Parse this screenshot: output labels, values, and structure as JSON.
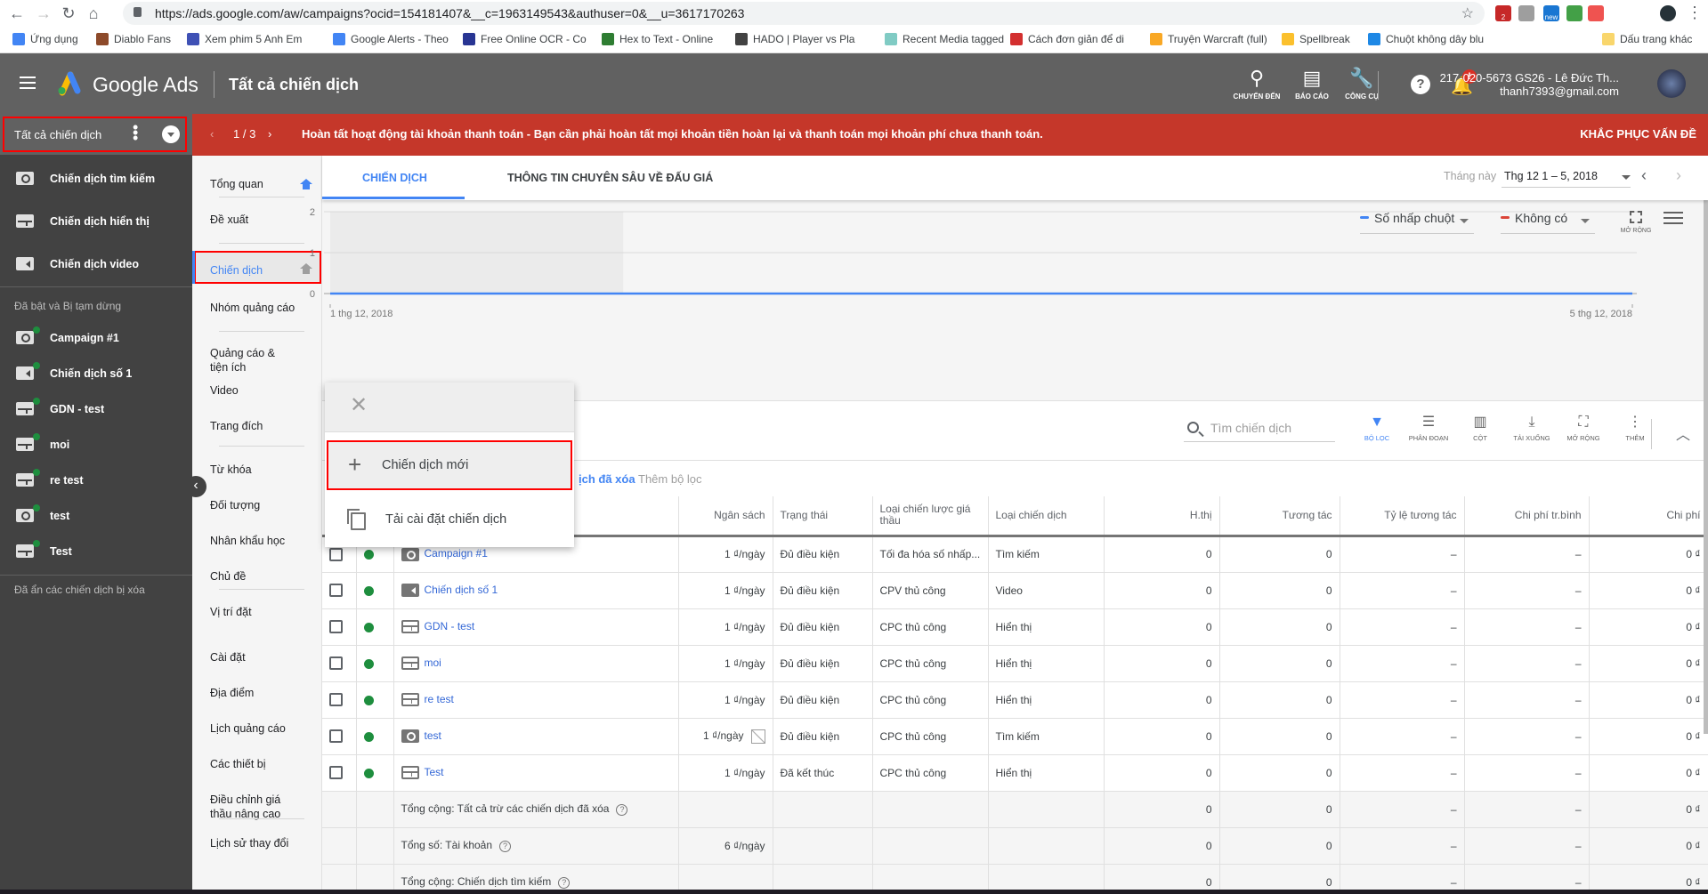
{
  "browser": {
    "url": "https://ads.google.com/aw/campaigns?ocid=154181407&__c=1963149543&authuser=0&__u=3617170263",
    "extensions": [
      {
        "name": "gmail-extension",
        "badge": "2",
        "color": "#c62828"
      },
      {
        "name": "shield-extension",
        "color": "#9e9e9e"
      },
      {
        "name": "new-extension",
        "badge": "new",
        "color": "#1976d2"
      },
      {
        "name": "globe-extension",
        "color": "#43a047"
      },
      {
        "name": "arrow-extension",
        "color": "#ef5350"
      }
    ],
    "bookmarks": [
      {
        "label": "Ứng dụng",
        "color": "#4285f4"
      },
      {
        "label": "Diablo Fans",
        "color": "#8d4a2a"
      },
      {
        "label": "Xem phim 5 Anh Em",
        "color": "#3f51b5"
      },
      {
        "label": "Google Alerts - Theo",
        "color": "#4285f4"
      },
      {
        "label": "Free Online OCR - Co",
        "color": "#283593"
      },
      {
        "label": "Hex to Text - Online",
        "color": "#2e7d32"
      },
      {
        "label": "HADO | Player vs Pla",
        "color": "#424242"
      },
      {
        "label": "Recent Media tagged",
        "color": "#80cbc4"
      },
      {
        "label": "Cách đơn giản để di",
        "color": "#d32f2f"
      },
      {
        "label": "Truyện Warcraft (full)",
        "color": "#f9a825"
      },
      {
        "label": "Spellbreak",
        "color": "#fbc02d"
      },
      {
        "label": "Chuột không dây blu",
        "color": "#1e88e5"
      }
    ],
    "other_bookmarks": "Dấu trang khác"
  },
  "header": {
    "brand": "Google Ads",
    "title": "Tất cả chiến dịch",
    "tools": [
      {
        "label": "CHUYỂN ĐẾN",
        "icon": "search-icon"
      },
      {
        "label": "BÁO CÁO",
        "icon": "report-icon"
      },
      {
        "label": "CÔNG CỤ",
        "icon": "wrench-icon"
      }
    ],
    "notification_badge": "!",
    "account_line1": "217-020-5673 GS26 - Lê Đức Th...",
    "account_line2": "thanh7393@gmail.com"
  },
  "left_nav": {
    "title": "Tất cả chiến dịch",
    "types": [
      {
        "label": "Chiến dịch tìm kiếm",
        "type": "search"
      },
      {
        "label": "Chiến dịch hiển thị",
        "type": "display"
      },
      {
        "label": "Chiến dịch video",
        "type": "video"
      }
    ],
    "section_enabled": "Đã bật và Bị tạm dừng",
    "campaigns": [
      {
        "label": "Campaign #1",
        "type": "search"
      },
      {
        "label": "Chiến dịch số 1",
        "type": "video"
      },
      {
        "label": "GDN - test",
        "type": "display"
      },
      {
        "label": "moi",
        "type": "display"
      },
      {
        "label": "re test",
        "type": "display"
      },
      {
        "label": "test",
        "type": "search"
      },
      {
        "label": "Test",
        "type": "display"
      }
    ],
    "hidden_note": "Đã ẩn các chiến dịch bị xóa"
  },
  "alert": {
    "pager": "1 / 3",
    "message": "Hoàn tất hoạt động tài khoản thanh toán - Bạn cần phải hoàn tất mọi khoản tiền hoàn lại và thanh toán mọi khoản phí chưa thanh toán.",
    "action": "KHẮC PHỤC VẤN ĐỀ"
  },
  "page_nav": {
    "items": [
      {
        "label": "Tổng quan"
      },
      {
        "label": "Đề xuất"
      },
      {
        "label": "Chiến dịch",
        "active": true
      },
      {
        "label": "Nhóm quảng cáo"
      },
      {
        "label": "Quảng cáo & tiện ích"
      },
      {
        "label": "Video"
      },
      {
        "label": "Trang đích"
      },
      {
        "label": "Từ khóa"
      },
      {
        "label": "Đối tượng"
      },
      {
        "label": "Nhân khẩu học"
      },
      {
        "label": "Chủ đề"
      },
      {
        "label": "Vị trí đặt"
      },
      {
        "label": "Cài đặt"
      },
      {
        "label": "Địa điểm"
      },
      {
        "label": "Lịch quảng cáo"
      },
      {
        "label": "Các thiết bị"
      },
      {
        "label": "Điều chỉnh giá thầu nâng cao"
      },
      {
        "label": "Lịch sử thay đổi"
      }
    ]
  },
  "tabs": [
    {
      "label": "CHIẾN DỊCH",
      "active": true
    },
    {
      "label": "THÔNG TIN CHUYÊN SÂU VỀ ĐẤU GIÁ"
    }
  ],
  "date_range": {
    "label": "Tháng này",
    "value": "Thg 12 1 – 5, 2018"
  },
  "chart_controls": {
    "metric1": "Số nhấp chuột",
    "metric1_color": "#4285f4",
    "metric2": "Không có",
    "metric2_color": "#db4437",
    "expand": "MỞ RỘNG"
  },
  "chart_data": {
    "type": "line",
    "title": "",
    "xlabel": "",
    "ylabel": "",
    "x": [
      "1 thg 12, 2018",
      "2 thg 12, 2018",
      "3 thg 12, 2018",
      "4 thg 12, 2018",
      "5 thg 12, 2018"
    ],
    "x_tick_labels": [
      "1 thg 12, 2018",
      "5 thg 12, 2018"
    ],
    "series": [
      {
        "name": "Số nhấp chuột",
        "values": [
          0,
          0,
          0,
          0,
          0
        ],
        "color": "#4285f4"
      }
    ],
    "ylim": [
      0,
      2
    ],
    "y_ticks": [
      0,
      1,
      2
    ],
    "grid": true,
    "highlighted_range": [
      "1 thg 12, 2018",
      "2 thg 12, 2018"
    ]
  },
  "table_toolbar": {
    "search_placeholder": "Tìm chiến dịch",
    "buttons": [
      {
        "label": "BỘ LỌC",
        "icon": "filter-icon",
        "active": true
      },
      {
        "label": "PHÂN ĐOẠN",
        "icon": "segment-icon"
      },
      {
        "label": "CỘT",
        "icon": "columns-icon"
      },
      {
        "label": "TẢI XUỐNG",
        "icon": "download-icon"
      },
      {
        "label": "MỞ RỘNG",
        "icon": "expand-icon"
      },
      {
        "label": "THÊM",
        "icon": "more-icon"
      }
    ]
  },
  "filter": {
    "active_text": "ịch đã xóa",
    "add_label": "Thêm bộ lọc"
  },
  "popup_menu": {
    "items": [
      {
        "label": "Chiến dịch mới",
        "icon": "plus-icon"
      },
      {
        "label": "Tải cài đặt chiến dịch",
        "icon": "copy-icon"
      }
    ]
  },
  "table": {
    "columns": [
      "",
      "",
      "Chiến dịch",
      "Ngân sách",
      "Trạng thái",
      "Loại chiến lược giá thầu",
      "Loại chiến dịch",
      "H.thị",
      "Tương tác",
      "Tỷ lệ tương tác",
      "Chi phí tr.bình",
      "Chi phí"
    ],
    "rows": [
      {
        "name": "Campaign #1",
        "type": "search",
        "budget": "1 ₫/ngày",
        "status": "Đủ điều kiện",
        "bid": "Tối đa hóa số nhấp...",
        "bid_link": true,
        "ctype": "Tìm kiếm",
        "impr": "0",
        "inter": "0",
        "rate": "–",
        "avg": "–",
        "cost": "0 ₫"
      },
      {
        "name": "Chiến dịch số 1",
        "type": "video",
        "budget": "1 ₫/ngày",
        "status": "Đủ điều kiện",
        "bid": "CPV thủ công",
        "ctype": "Video",
        "impr": "0",
        "inter": "0",
        "rate": "–",
        "avg": "–",
        "cost": "0 ₫"
      },
      {
        "name": "GDN - test",
        "type": "display",
        "budget": "1 ₫/ngày",
        "status": "Đủ điều kiện",
        "bid": "CPC thủ công",
        "ctype": "Hiển thị",
        "impr": "0",
        "inter": "0",
        "rate": "–",
        "avg": "–",
        "cost": "0 ₫"
      },
      {
        "name": "moi",
        "type": "display",
        "budget": "1 ₫/ngày",
        "status": "Đủ điều kiện",
        "bid": "CPC thủ công",
        "ctype": "Hiển thị",
        "impr": "0",
        "inter": "0",
        "rate": "–",
        "avg": "–",
        "cost": "0 ₫"
      },
      {
        "name": "re test",
        "type": "display",
        "budget": "1 ₫/ngày",
        "status": "Đủ điều kiện",
        "bid": "CPC thủ công",
        "ctype": "Hiển thị",
        "impr": "0",
        "inter": "0",
        "rate": "–",
        "avg": "–",
        "cost": "0 ₫"
      },
      {
        "name": "test",
        "type": "search",
        "budget": "1 ₫/ngày",
        "budget_warning": true,
        "status": "Đủ điều kiện",
        "bid": "CPC thủ công",
        "ctype": "Tìm kiếm",
        "impr": "0",
        "inter": "0",
        "rate": "–",
        "avg": "–",
        "cost": "0 ₫"
      },
      {
        "name": "Test",
        "type": "display",
        "budget": "1 ₫/ngày",
        "status": "Đã kết thúc",
        "status_ended": true,
        "bid": "CPC thủ công",
        "ctype": "Hiển thị",
        "impr": "0",
        "inter": "0",
        "rate": "–",
        "avg": "–",
        "cost": "0 ₫"
      }
    ],
    "totals": [
      {
        "label": "Tổng cộng: Tất cả trừ các chiến dịch đã xóa",
        "budget": "",
        "impr": "0",
        "inter": "0",
        "rate": "–",
        "avg": "–",
        "cost": "0 ₫"
      },
      {
        "label": "Tổng số: Tài khoản",
        "budget": "6 ₫/ngày",
        "impr": "0",
        "inter": "0",
        "rate": "–",
        "avg": "–",
        "cost": "0 ₫"
      },
      {
        "label": "Tổng cộng: Chiến dịch tìm kiếm",
        "budget": "",
        "impr": "0",
        "inter": "0",
        "rate": "–",
        "avg": "–",
        "cost": "0 ₫"
      }
    ]
  }
}
